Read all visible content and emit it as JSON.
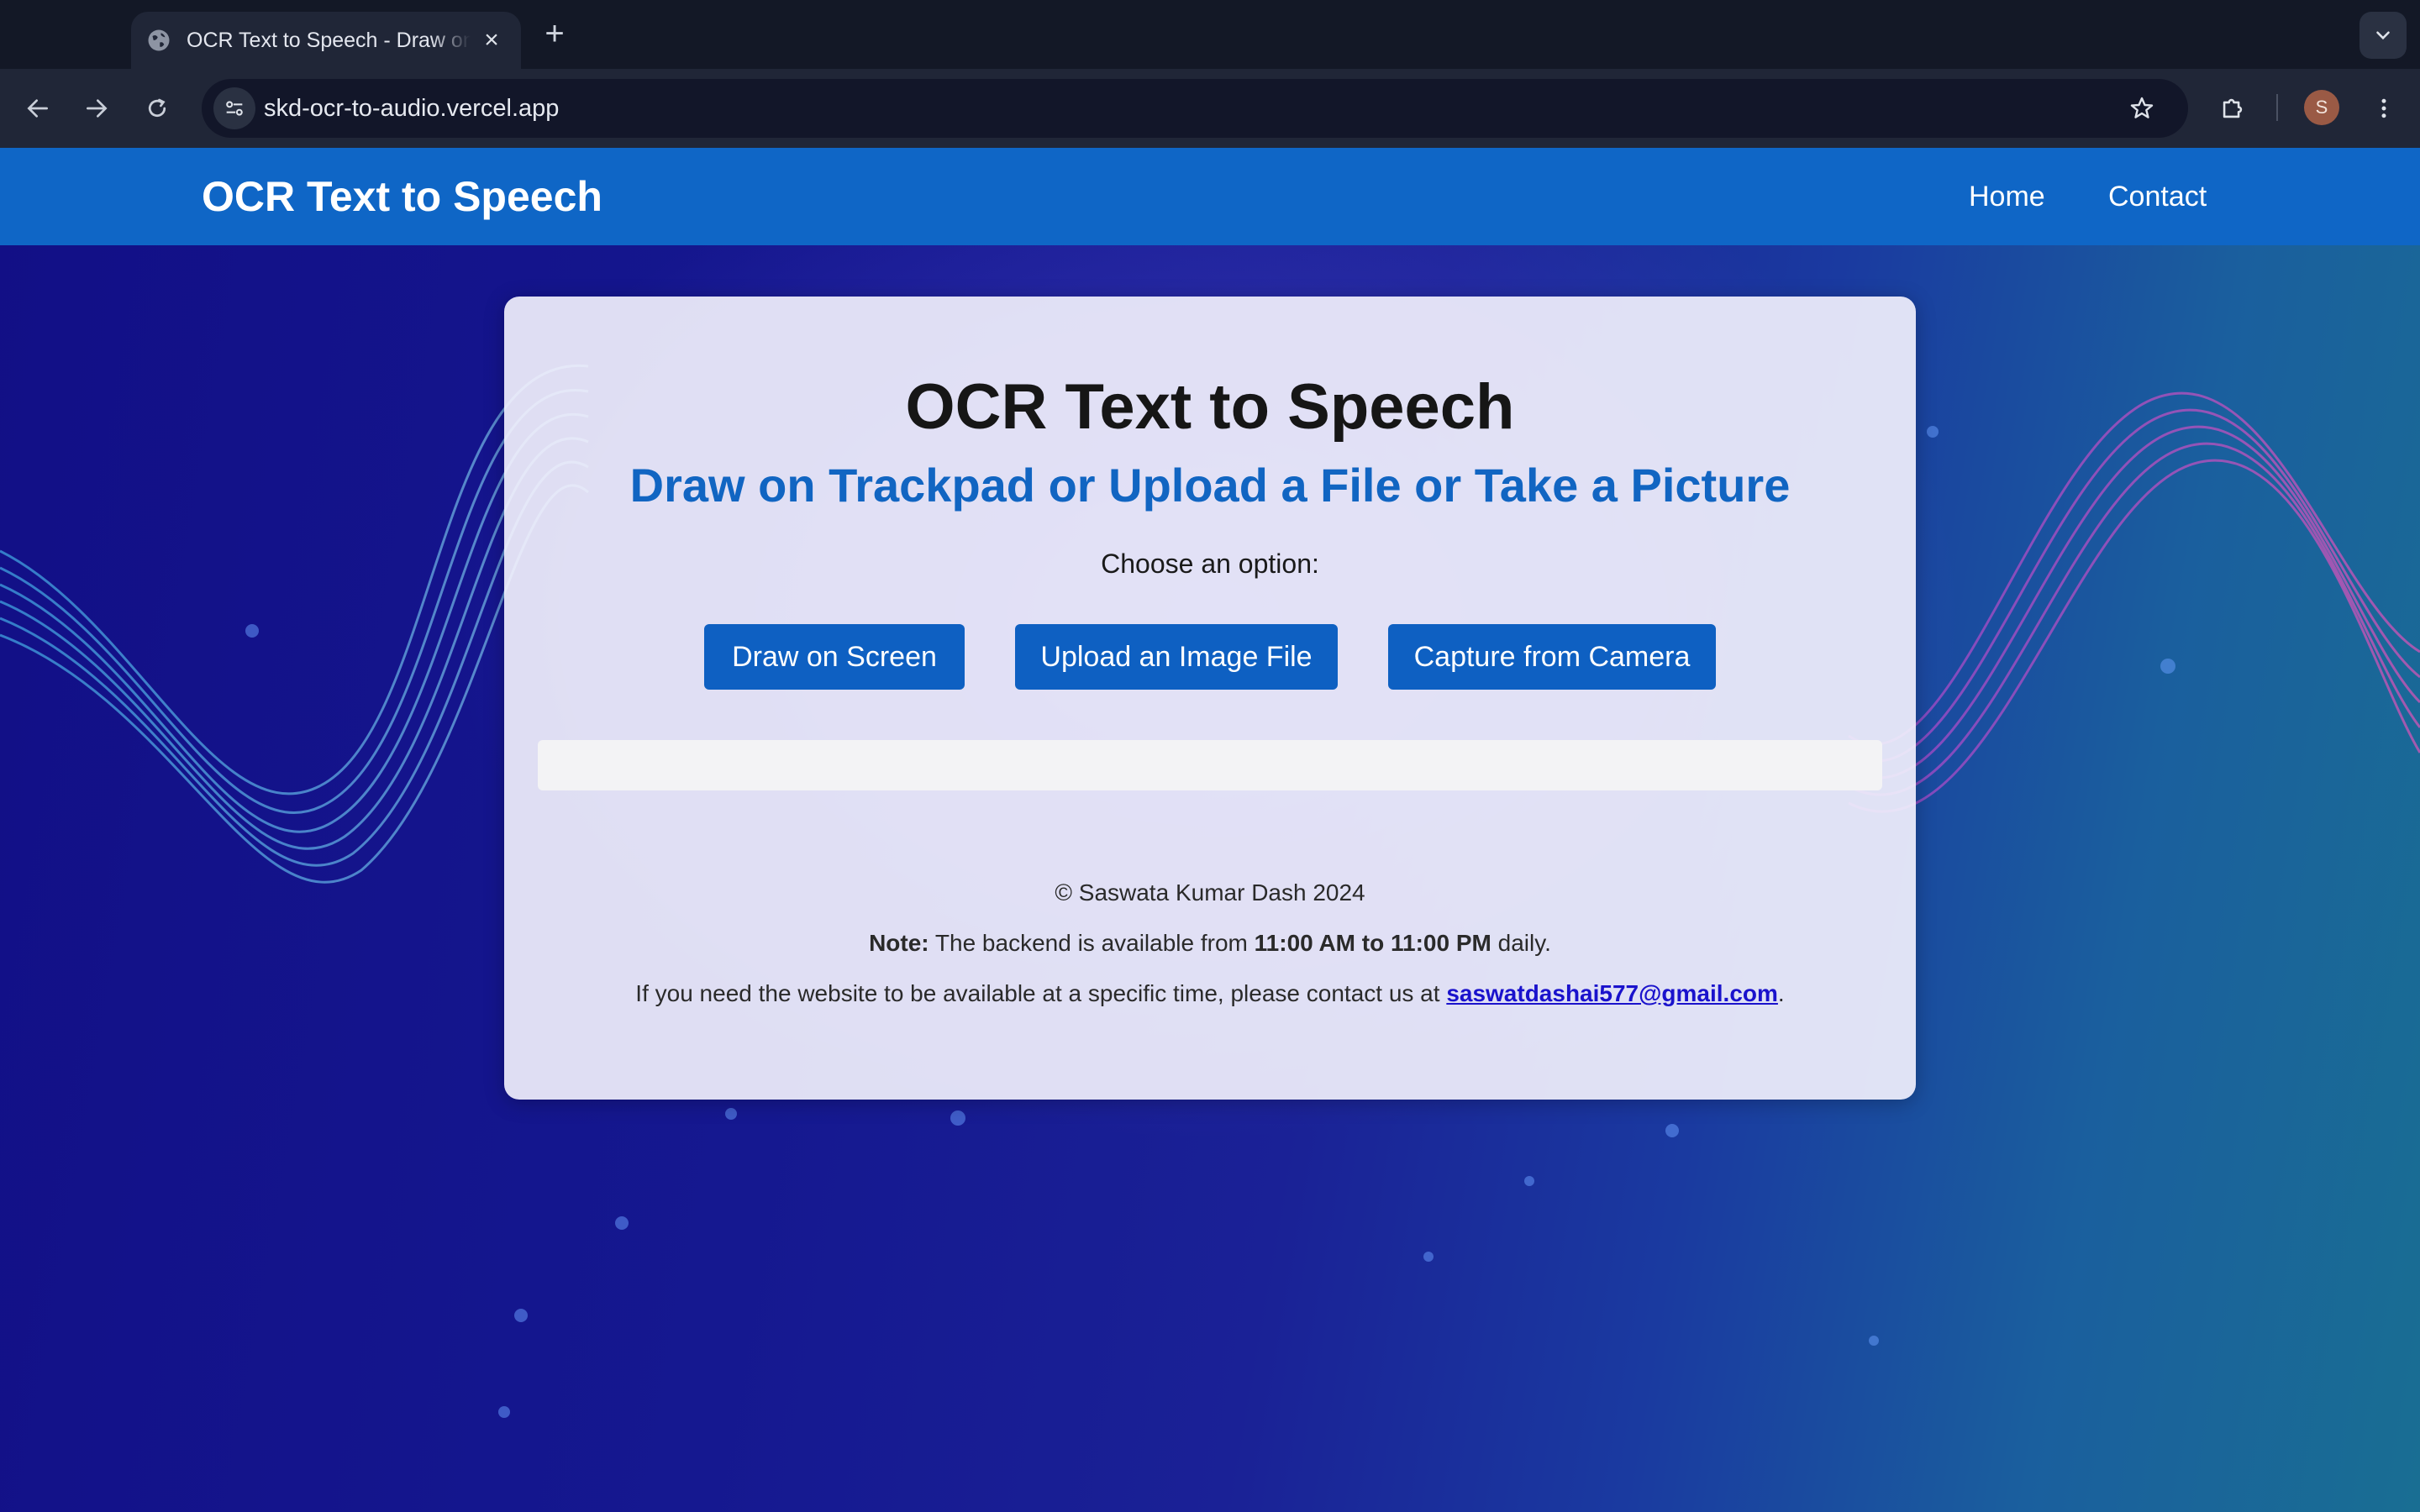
{
  "browser": {
    "tab_title": "OCR Text to Speech - Draw on Screen",
    "url": "skd-ocr-to-audio.vercel.app",
    "avatar_letter": "S",
    "new_tab_glyph": "+",
    "close_glyph": "×"
  },
  "header": {
    "brand": "OCR Text to Speech",
    "nav": [
      "Home",
      "Contact"
    ]
  },
  "main": {
    "title": "OCR Text to Speech",
    "subtitle": "Draw on Trackpad or Upload a File or Take a Picture",
    "prompt": "Choose an option:",
    "buttons": [
      "Draw on Screen",
      "Upload an Image File",
      "Capture from Camera"
    ],
    "output_text": ""
  },
  "footer": {
    "copyright": "© Saswata Kumar Dash 2024",
    "note_label": "Note:",
    "note_pre": " The backend is available from ",
    "note_hours": "11:00 AM to 11:00 PM",
    "note_post": " daily.",
    "contact_pre": "If you need the website to be available at a specific time, please contact us at ",
    "email": "saswatdashai577@gmail.com",
    "contact_post": "."
  },
  "colors": {
    "header_bg": "#0f66c6",
    "button_bg": "#0e60c2",
    "subtitle": "#1165c2",
    "link": "#1a12cc"
  },
  "icons": [
    "globe-icon",
    "close-icon",
    "plus-icon",
    "chevron-down-icon",
    "back-arrow-icon",
    "forward-arrow-icon",
    "reload-icon",
    "site-info-icon",
    "star-icon",
    "extensions-icon",
    "more-vert-icon"
  ]
}
